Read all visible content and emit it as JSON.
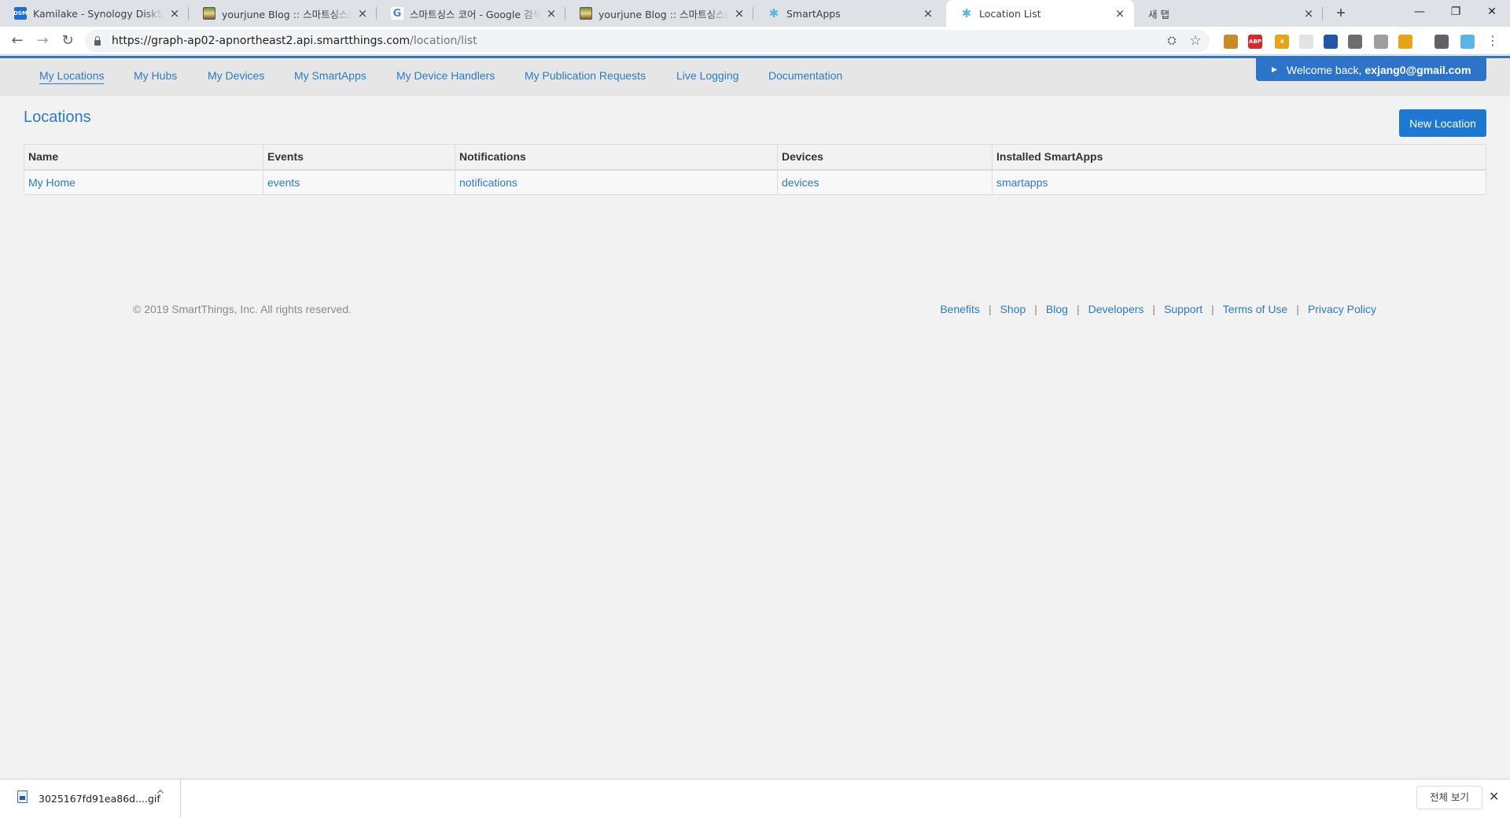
{
  "browser": {
    "tabs": [
      {
        "title": "Kamilake - Synology DiskStation",
        "icon": "synology-dsm-icon",
        "icon_text": "DSM"
      },
      {
        "title": "yourjune Blog :: 스마트싱스(SmartThings)",
        "icon": "blog-favicon-icon"
      },
      {
        "title": "스마트싱스 코어 - Google 검색",
        "icon": "google-icon",
        "icon_text": "G"
      },
      {
        "title": "yourjune Blog :: 스마트싱스(SmartThings)",
        "icon": "blog-favicon-icon"
      },
      {
        "title": "SmartApps",
        "icon": "smartthings-icon",
        "icon_text": "✱"
      },
      {
        "title": "Location List",
        "icon": "smartthings-icon",
        "icon_text": "✱"
      },
      {
        "title": "새 탭",
        "icon": ""
      }
    ],
    "tab_close_glyph": "×",
    "new_tab_glyph": "+",
    "window_controls": {
      "minimize": "—",
      "restore": "❐",
      "close": "✕"
    },
    "nav": {
      "back": "←",
      "forward": "→",
      "reload": "↻"
    },
    "url": {
      "host": "https://graph-ap02-apnortheast2.api.smartthings.com",
      "path": "/location/list"
    },
    "omnibox_icons": {
      "translate": "⛭",
      "bookmark": "☆"
    },
    "extensions": [
      {
        "name": "cookie-extension-icon",
        "label": "",
        "color": "#c98a2a"
      },
      {
        "name": "adblock-plus-icon",
        "label": "ABP",
        "color": "#d42a2a"
      },
      {
        "name": "puzzle-extension-icon",
        "label": "4",
        "color": "#e8a317"
      },
      {
        "name": "java-extension-icon",
        "label": "",
        "color": "#e3e3e3"
      },
      {
        "name": "translate-extension-icon",
        "label": "",
        "color": "#2457a3"
      },
      {
        "name": "recycle-extension-icon",
        "label": "",
        "color": "#6d6d6d"
      },
      {
        "name": "store-extension-icon",
        "label": "",
        "color": "#9e9e9e"
      },
      {
        "name": "link-extension-icon",
        "label": "",
        "color": "#e8a317"
      },
      {
        "name": "cast-icon",
        "label": "",
        "color": "#5f6368"
      },
      {
        "name": "profile-extension-icon",
        "label": "",
        "color": "#5ab4e5"
      }
    ],
    "menu_glyph": "⋮"
  },
  "subnav": {
    "items": [
      {
        "label": "My Locations",
        "active": true
      },
      {
        "label": "My Hubs"
      },
      {
        "label": "My Devices"
      },
      {
        "label": "My SmartApps"
      },
      {
        "label": "My Device Handlers"
      },
      {
        "label": "My Publication Requests"
      },
      {
        "label": "Live Logging"
      },
      {
        "label": "Documentation"
      }
    ],
    "welcome_prefix": "Welcome back,",
    "welcome_user": "exjang0@gmail.com"
  },
  "main": {
    "title": "Locations",
    "new_button": "New Location",
    "table": {
      "headers": [
        "Name",
        "Events",
        "Notifications",
        "Devices",
        "Installed SmartApps"
      ],
      "rows": [
        [
          "My Home",
          "events",
          "notifications",
          "devices",
          "smartapps"
        ]
      ]
    }
  },
  "footer": {
    "copyright": "© 2019 SmartThings, Inc. All rights reserved.",
    "links": [
      "Benefits",
      "Shop",
      "Blog",
      "Developers",
      "Support",
      "Terms of Use",
      "Privacy Policy"
    ],
    "separator": "|"
  },
  "downloads": {
    "file_name": "3025167fd91ea86d....gif",
    "chevron": "^",
    "show_all": "전체 보기",
    "close": "✕"
  },
  "colors": {
    "accent": "#2d74c8",
    "link": "#2a7bc4",
    "button": "#1e78d1"
  }
}
